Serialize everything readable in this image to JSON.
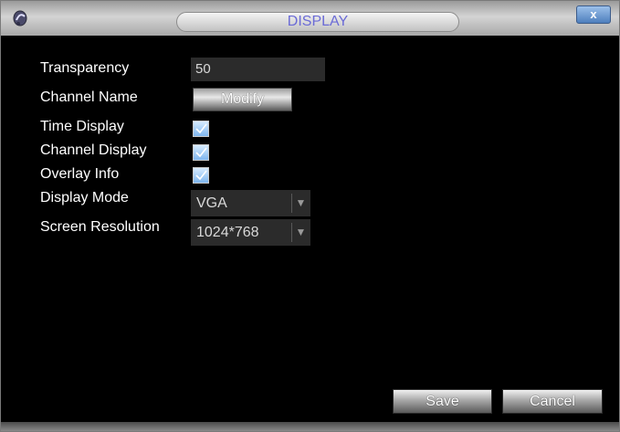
{
  "window": {
    "title": "DISPLAY",
    "close_label": "x"
  },
  "settings": {
    "transparency_label": "Transparency",
    "transparency_value": "50",
    "channel_name_label": "Channel Name",
    "modify_label": "Modify",
    "time_display_label": "Time Display",
    "time_display_checked": true,
    "channel_display_label": "Channel Display",
    "channel_display_checked": true,
    "overlay_info_label": "Overlay Info",
    "overlay_info_checked": true,
    "display_mode_label": "Display Mode",
    "display_mode_value": "VGA",
    "screen_resolution_label": "Screen Resolution",
    "screen_resolution_value": "1024*768"
  },
  "buttons": {
    "save_label": "Save",
    "cancel_label": "Cancel"
  },
  "icons": {
    "app": "app-logo-icon",
    "close": "close-icon",
    "checkbox": "checkmark-icon",
    "dropdown": "triangle-down-icon"
  },
  "colors": {
    "title_text": "#6b6bd6",
    "background": "#000000",
    "checkbox_fill": "#7fb6ef"
  }
}
